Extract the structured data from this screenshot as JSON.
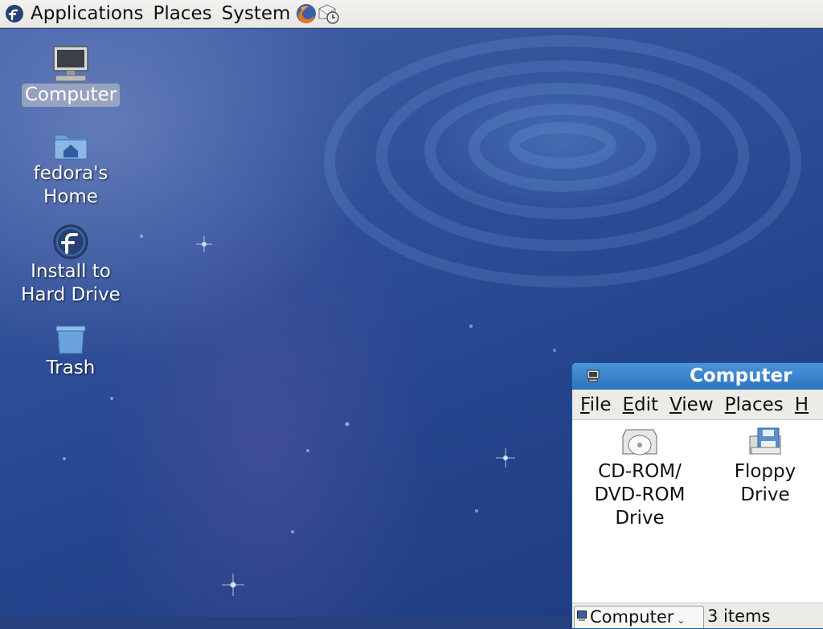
{
  "panel": {
    "menus": [
      "Applications",
      "Places",
      "System"
    ],
    "launchers": [
      "firefox-icon",
      "mail-clock-icon"
    ]
  },
  "desktop": {
    "icons": [
      {
        "name": "computer",
        "label_lines": [
          "Computer"
        ],
        "icon": "computer-icon",
        "selected": true
      },
      {
        "name": "home",
        "label_lines": [
          "fedora's",
          "Home"
        ],
        "icon": "home-folder-icon",
        "selected": false
      },
      {
        "name": "install",
        "label_lines": [
          "Install to",
          "Hard Drive"
        ],
        "icon": "fedora-logo-icon",
        "selected": false
      },
      {
        "name": "trash",
        "label_lines": [
          "Trash"
        ],
        "icon": "trash-icon",
        "selected": false
      }
    ]
  },
  "window": {
    "title": "Computer",
    "menus": [
      {
        "label": "File",
        "mnemonic": "F"
      },
      {
        "label": "Edit",
        "mnemonic": "E"
      },
      {
        "label": "View",
        "mnemonic": "V"
      },
      {
        "label": "Places",
        "mnemonic": "P"
      },
      {
        "label": "H",
        "mnemonic": "H"
      }
    ],
    "items": [
      {
        "label_lines": [
          "CD-ROM/",
          "DVD-ROM",
          "Drive"
        ],
        "icon": "cdrom-drive-icon"
      },
      {
        "label_lines": [
          "Floppy",
          "Drive"
        ],
        "icon": "floppy-drive-icon"
      }
    ],
    "location": "Computer",
    "status": "3 items"
  },
  "colors": {
    "title_bar": "#2c75bf",
    "desktop": "#27407e"
  }
}
